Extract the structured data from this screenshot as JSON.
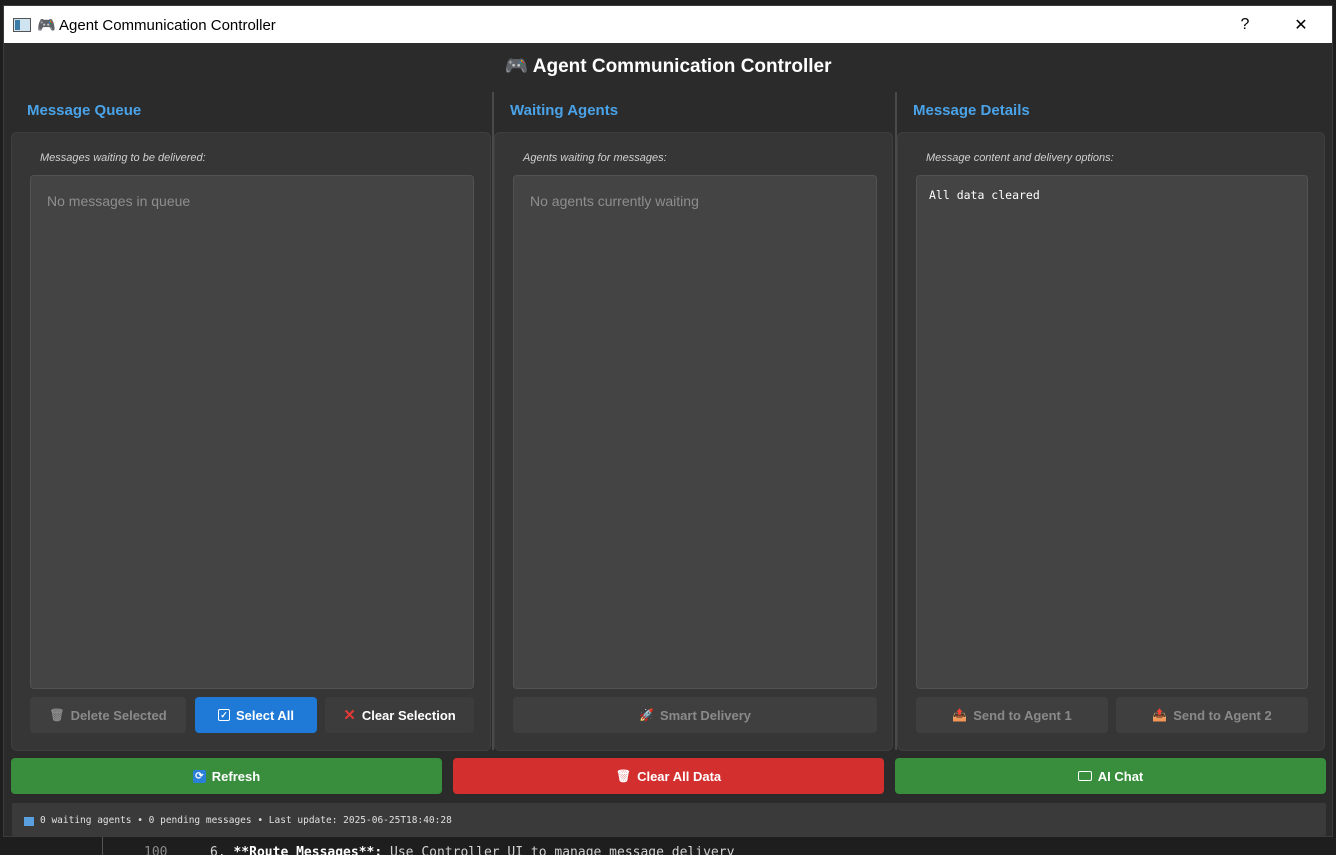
{
  "window": {
    "title": "🎮 Agent Communication Controller",
    "help_label": "?",
    "close_label": "✕"
  },
  "header": {
    "title": "🎮 Agent Communication Controller"
  },
  "panels": {
    "queue": {
      "title": "Message Queue",
      "subtitle": "Messages waiting to be delivered:",
      "empty_text": "No messages in queue",
      "buttons": {
        "delete": "Delete Selected",
        "select_all": "Select All",
        "clear_selection": "Clear Selection"
      }
    },
    "agents": {
      "title": "Waiting Agents",
      "subtitle": "Agents waiting for messages:",
      "empty_text": "No agents currently waiting",
      "buttons": {
        "smart_delivery": "Smart Delivery"
      }
    },
    "details": {
      "title": "Message Details",
      "subtitle": "Message content and delivery options:",
      "content": "All data cleared",
      "buttons": {
        "send_agent_1": "Send to Agent 1",
        "send_agent_2": "Send to Agent 2"
      }
    }
  },
  "actions": {
    "refresh": "Refresh",
    "clear_all": "Clear All Data",
    "ai_chat": "AI Chat"
  },
  "status": {
    "text": "0 waiting agents • 0 pending messages • Last update: 2025-06-25T18:40:28"
  },
  "background_editor": {
    "line_number": "100",
    "line_prefix": "6.",
    "line_bold": "**Route Messages**:",
    "line_rest": "Use Controller UI to manage message delivery"
  },
  "colors": {
    "accent_blue": "#4aa3e8",
    "select_all_blue": "#1e7ad6",
    "green": "#388e3c",
    "red": "#d32f2f"
  }
}
